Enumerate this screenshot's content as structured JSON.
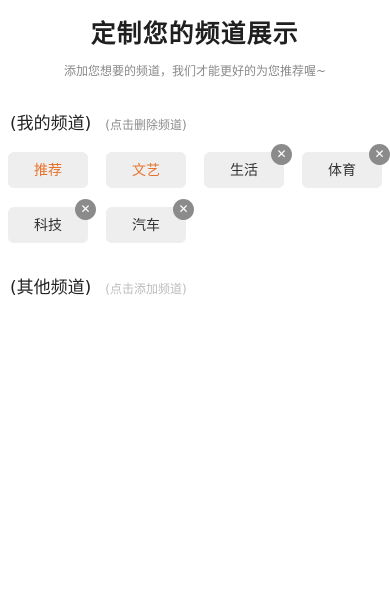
{
  "header": {
    "title": "定制您的频道展示",
    "subtitle": "添加您想要的频道，我们才能更好的为您推荐喔~"
  },
  "my_channels": {
    "title": "(我的频道)",
    "hint": "(点击删除频道)",
    "items": [
      {
        "label": "推荐",
        "removable": false
      },
      {
        "label": "文艺",
        "removable": false
      },
      {
        "label": "生活",
        "removable": true
      },
      {
        "label": "体育",
        "removable": true
      },
      {
        "label": "科技",
        "removable": true
      },
      {
        "label": "汽车",
        "removable": true
      }
    ]
  },
  "other_channels": {
    "title": "(其他频道)",
    "hint": "(点击添加频道)"
  },
  "icons": {
    "remove": "close-icon"
  },
  "colors": {
    "fixed_channel_text": "#e8742b",
    "chip_background": "#eeeeee",
    "remove_badge": "#8b8b8b"
  }
}
